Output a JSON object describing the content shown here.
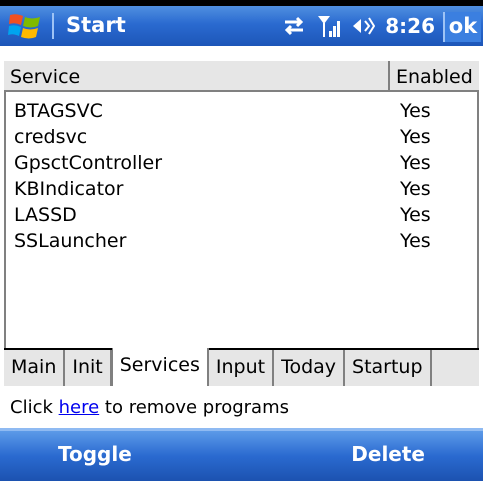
{
  "titlebar": {
    "title": "Start",
    "time": "8:26",
    "ok_label": "ok"
  },
  "list": {
    "headers": {
      "service": "Service",
      "enabled": "Enabled"
    },
    "rows": [
      {
        "name": "BTAGSVC",
        "enabled": "Yes"
      },
      {
        "name": "credsvc",
        "enabled": "Yes"
      },
      {
        "name": "GpsctController",
        "enabled": "Yes"
      },
      {
        "name": "KBIndicator",
        "enabled": "Yes"
      },
      {
        "name": "LASSD",
        "enabled": "Yes"
      },
      {
        "name": "SSLauncher",
        "enabled": "Yes"
      }
    ]
  },
  "tabs": [
    "Main",
    "Init",
    "Services",
    "Input",
    "Today",
    "Startup"
  ],
  "active_tab": "Services",
  "footer": {
    "prefix": "Click ",
    "link": "here",
    "suffix": " to remove programs"
  },
  "softkeys": {
    "left": "Toggle",
    "right": "Delete"
  },
  "icons": {
    "logo": "windows-flag-icon",
    "sync": "sync-icon",
    "signal": "signal-icon",
    "volume": "volume-icon"
  },
  "colors": {
    "title_bar": "#2a6ad0",
    "link": "#0000ee"
  }
}
